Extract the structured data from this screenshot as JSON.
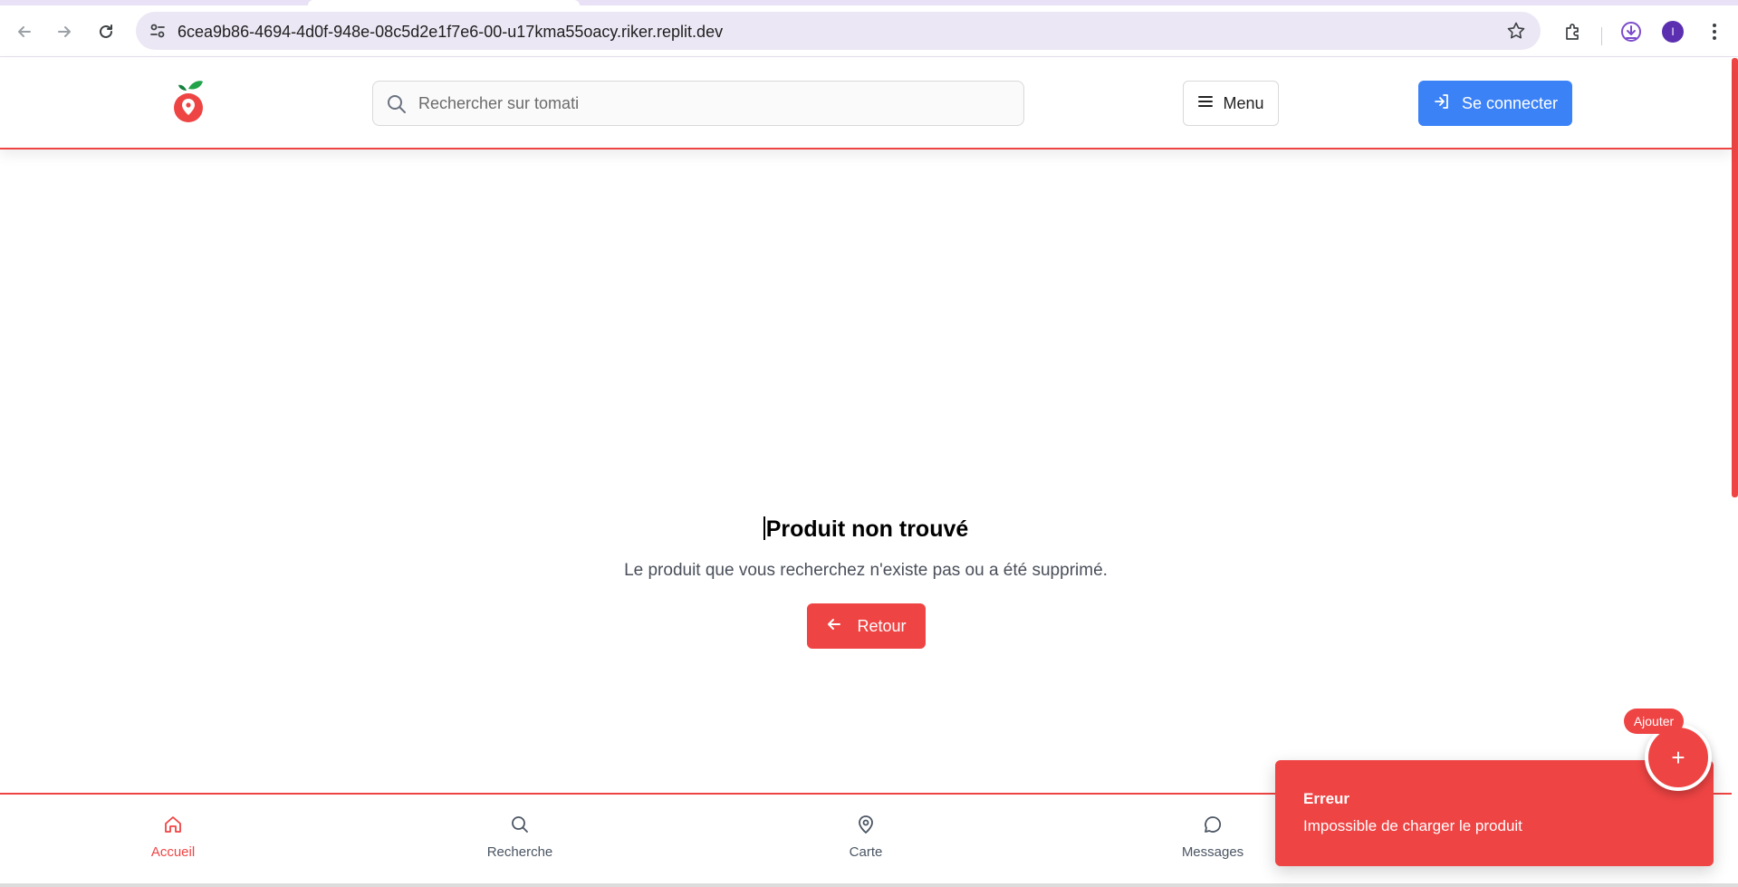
{
  "browser": {
    "url": "6cea9b86-4694-4d0f-948e-08c5d2e1f7e6-00-u17kma55oacy.riker.replit.dev",
    "profile_initial": "I"
  },
  "header": {
    "search_placeholder": "Rechercher sur tomati",
    "menu_label": "Menu",
    "login_label": "Se connecter",
    "brand_color": "#ef4444",
    "login_color": "#3b82f6"
  },
  "main": {
    "title": "Produit non trouvé",
    "message": "Le produit que vous recherchez n'existe pas ou a été supprimé.",
    "back_label": "Retour"
  },
  "bottom_nav": {
    "items": [
      {
        "label": "Accueil",
        "icon": "home-icon",
        "active": true
      },
      {
        "label": "Recherche",
        "icon": "search-icon",
        "active": false
      },
      {
        "label": "Carte",
        "icon": "map-pin-icon",
        "active": false
      },
      {
        "label": "Messages",
        "icon": "message-icon",
        "active": false
      }
    ]
  },
  "toast": {
    "title": "Erreur",
    "message": "Impossible de charger le produit"
  },
  "fab": {
    "label": "Ajouter",
    "symbol": "+"
  }
}
